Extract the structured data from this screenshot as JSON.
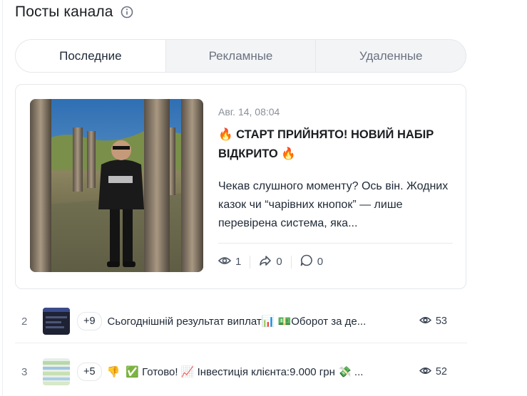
{
  "header": {
    "title": "Посты канала",
    "info_icon": "info-icon"
  },
  "tabs": [
    {
      "label": "Последние",
      "active": true
    },
    {
      "label": "Рекламные",
      "active": false
    },
    {
      "label": "Удаленные",
      "active": false
    }
  ],
  "featured_post": {
    "date": "Авг. 14, 08:04",
    "title": "🔥 СТАРТ ПРИЙНЯТО! НОВИЙ НАБІР ВІДКРИТО 🔥",
    "body": "Чекав слушного моменту? Ось він. Жодних казок чи “чарівних кнопок” — лише перевірена система, яка...",
    "stats": {
      "views": "1",
      "shares": "0",
      "comments": "0"
    }
  },
  "posts": [
    {
      "rank": "2",
      "extra_count": "+9",
      "reaction": "",
      "text": "Сьогоднішній результат виплат📊 💵Оборот за де...",
      "views": "53"
    },
    {
      "rank": "3",
      "extra_count": "+5",
      "reaction": "👎",
      "text": "✅ Готово! 📈 Інвестиція клієнта:9.000 грн 💸 ...",
      "views": "52"
    }
  ],
  "colors": {
    "accent": "#1f2937",
    "muted": "#8a9099",
    "border": "#e5e7eb",
    "tab_bg": "#f3f4f6"
  }
}
